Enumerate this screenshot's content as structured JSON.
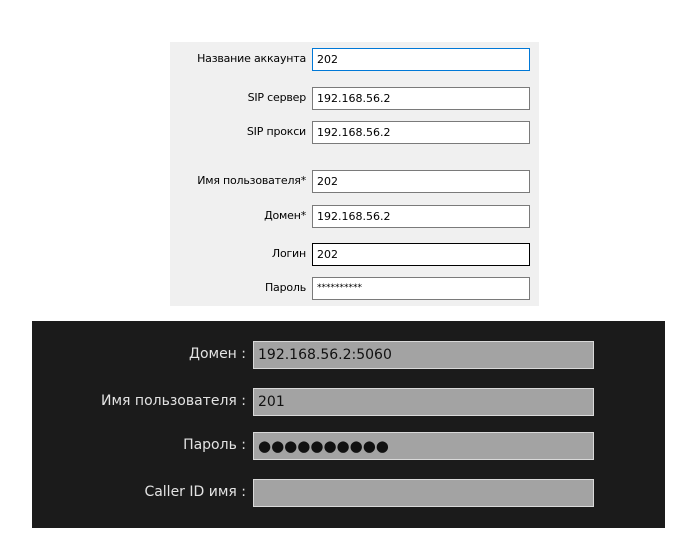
{
  "account_form": {
    "fields": [
      {
        "label": "Название аккаунта",
        "value": "202"
      },
      {
        "label": "SIP сервер",
        "value": "192.168.56.2"
      },
      {
        "label": "SIP прокси",
        "value": "192.168.56.2"
      },
      {
        "label": "Имя пользователя*",
        "value": "202"
      },
      {
        "label": "Домен*",
        "value": "192.168.56.2"
      },
      {
        "label": "Логин",
        "value": "202"
      },
      {
        "label": "Пароль",
        "value": "**********"
      }
    ]
  },
  "dark_form": {
    "fields": [
      {
        "label": "Домен :",
        "value": "192.168.56.2:5060"
      },
      {
        "label": "Имя пользователя :",
        "value": "201"
      },
      {
        "label": "Пароль :",
        "value": "●●●●●●●●●●"
      },
      {
        "label": "Caller ID имя :",
        "value": ""
      }
    ]
  },
  "colors": {
    "light_panel_bg": "#f0f0f0",
    "light_active_border": "#0078d7",
    "dark_panel_bg": "#1b1b1b",
    "dark_input_bg": "#a3a3a3",
    "dark_label_text": "#e3e3e3"
  }
}
